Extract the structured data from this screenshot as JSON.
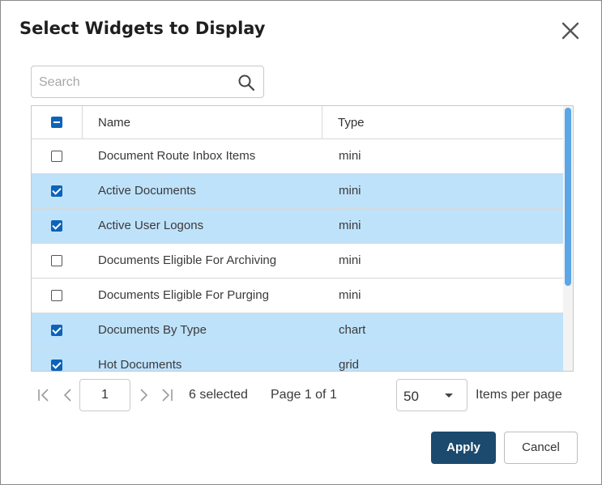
{
  "dialog": {
    "title": "Select Widgets to Display",
    "close_icon": "close-icon"
  },
  "search": {
    "placeholder": "Search",
    "value": "",
    "icon": "search-icon"
  },
  "grid": {
    "header_checkbox_state": "indeterminate",
    "columns": [
      "Name",
      "Type"
    ],
    "rows": [
      {
        "name": "Document Route Inbox Items",
        "type": "mini",
        "checked": false
      },
      {
        "name": "Active Documents",
        "type": "mini",
        "checked": true
      },
      {
        "name": "Active User Logons",
        "type": "mini",
        "checked": true
      },
      {
        "name": "Documents Eligible For Archiving",
        "type": "mini",
        "checked": false
      },
      {
        "name": "Documents Eligible For Purging",
        "type": "mini",
        "checked": false
      },
      {
        "name": "Documents By Type",
        "type": "chart",
        "checked": true
      },
      {
        "name": "Hot Documents",
        "type": "grid",
        "checked": true
      }
    ],
    "selected_row_color": "#bfe2fb"
  },
  "pager": {
    "page_value": "1",
    "selected_text": "6 selected",
    "page_info": "Page 1 of 1",
    "items_per_page_value": "50",
    "items_per_page_label": "Items per page"
  },
  "actions": {
    "apply_label": "Apply",
    "cancel_label": "Cancel",
    "apply_color": "#1c4a6e"
  }
}
